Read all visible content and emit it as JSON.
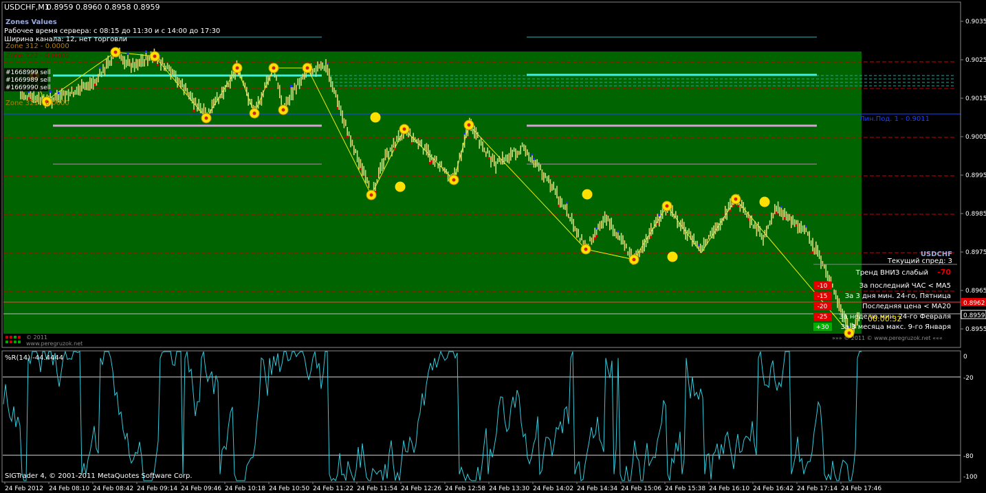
{
  "window": {
    "title": "USDCHF,M1",
    "ohlc": "0.8959 0.8960 0.8958 0.8959",
    "copyright": "SIGTrader 4, © 2001-2011 MetaQuotes Software Corp."
  },
  "zones_panel": {
    "title": "Zones Values",
    "server_time": "Рабочее время сервера: с 08:15 до 11:30 и с 14:00 до 17:30",
    "channel_width": "Ширина канала: 12, нет торговли",
    "zone_lines": [
      "Zone 312 - 0.0000",
      "Zone 322 - 0.0000",
      "Zone 321 - 0.0000"
    ],
    "order_labels": [
      "#1668999 sell",
      "#1669989 sell",
      "#1669990 sell"
    ],
    "logo_text": "© 2011",
    "logo_url": "www.peregruzok.net"
  },
  "price_axis": {
    "labels": [
      "0.9035",
      "0.9025",
      "0.9015",
      "0.9005",
      "0.8995",
      "0.8985",
      "0.8975",
      "0.8965",
      "0.8955"
    ],
    "current_bid": "0.8959",
    "red_level": "0.8962"
  },
  "levels": {
    "blue_line_label": "Лин.Под. 1 - 0.9011"
  },
  "info_panel": {
    "symbol": "USDCHF",
    "spread": "Текущий спред: 3",
    "trend_label": "Тренд ВНИЗ слабый",
    "trend_value": "-70",
    "rows": [
      {
        "badge": "-10",
        "badge_color": "#e00000",
        "text": "За последний ЧАС < MA5"
      },
      {
        "badge": "-15",
        "badge_color": "#e00000",
        "text": "За 3 дня мин. 24-го, Пятница"
      },
      {
        "badge": "-20",
        "badge_color": "#e00000",
        "text": "Последняя цена < MA20"
      },
      {
        "badge": "-25",
        "badge_color": "#e00000",
        "text": "За неделю мин. 24-го Февраля"
      },
      {
        "badge": "+30",
        "badge_color": "#00b000",
        "text": "За 3 месяца макс. 9-го Января"
      }
    ],
    "timer": "00:00:32",
    "footer": "»»» © 2011 © www.peregruzok.net «««"
  },
  "indicator": {
    "title": "%R(14) -44.4444",
    "levels": [
      "0",
      "-20",
      "-80",
      "-100"
    ],
    "color": "#33ccdd"
  },
  "time_axis": {
    "labels": [
      "24 Feb 2012",
      "24 Feb 08:10",
      "24 Feb 08:42",
      "24 Feb 09:14",
      "24 Feb 09:46",
      "24 Feb 10:18",
      "24 Feb 10:50",
      "24 Feb 11:22",
      "24 Feb 11:54",
      "24 Feb 12:26",
      "24 Feb 12:58",
      "24 Feb 13:30",
      "24 Feb 14:02",
      "24 Feb 14:34",
      "24 Feb 15:06",
      "24 Feb 15:38",
      "24 Feb 16:10",
      "24 Feb 16:42",
      "24 Feb 17:14",
      "24 Feb 17:46"
    ]
  },
  "colors": {
    "zone_green": "#006400",
    "bars": "#d8dc78",
    "zigzag": "#f0f000",
    "cyan_level": "#40f0e0",
    "pink_level": "#d8a0d8",
    "red_dashed": "#d00000",
    "blue_line": "#2040ff",
    "marker_yellow": "#ffe000"
  }
}
